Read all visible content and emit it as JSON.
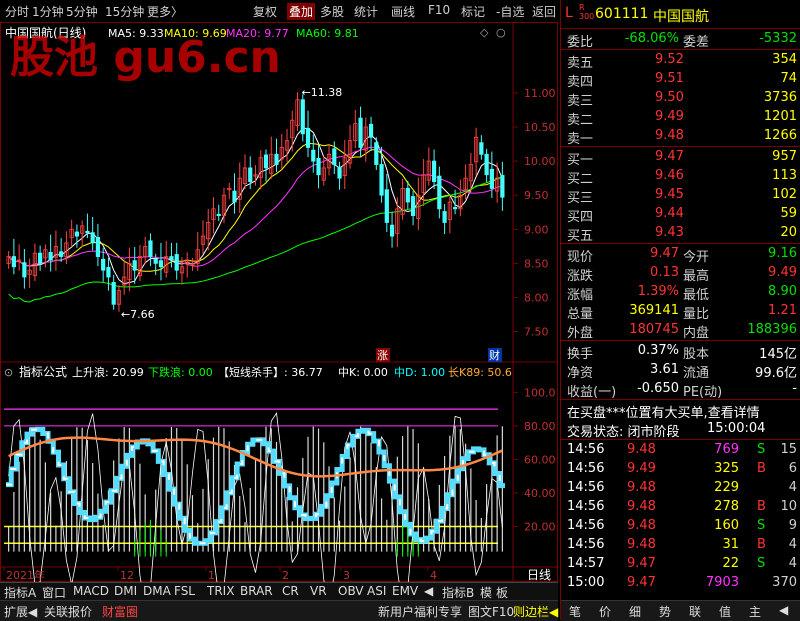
{
  "toolbar": {
    "items": [
      "分时",
      "1分钟",
      "5分钟",
      "15分钟",
      "更多〉",
      "复权",
      "叠加",
      "多股",
      "统计",
      "画线",
      "F10",
      "标记",
      "-自选",
      "返回"
    ],
    "active_index": 6
  },
  "main_chart": {
    "title": "中国国航(日线)",
    "ma_labels": [
      {
        "text": "MA5: 9.33",
        "color": "#ffffff"
      },
      {
        "text": "MA10: 9.69",
        "color": "#ffff00"
      },
      {
        "text": "MA20: 9.77",
        "color": "#ff33ff"
      },
      {
        "text": "MA60: 9.81",
        "color": "#00ff00"
      }
    ],
    "watermark": "股池 gu6.cn",
    "high_label": "←11.38",
    "low_label": "←7.66",
    "y_ticks": [
      "11.00",
      "10.50",
      "10.00",
      "9.50",
      "9.00",
      "8.50",
      "8.00",
      "7.50"
    ],
    "marker_zhang": "涨",
    "marker_cai": "财"
  },
  "indicator": {
    "header": "指标公式",
    "labels": [
      {
        "text": "上升浪: 20.99",
        "color": "#ffffff"
      },
      {
        "text": "下跌浪: 0.00",
        "color": "#00ff00"
      },
      {
        "text": "【短线杀手】: 36.77",
        "color": "#ffffff"
      },
      {
        "text": "中K: 0.00",
        "color": "#ffffff"
      },
      {
        "text": "中D: 1.00",
        "color": "#00ffff"
      },
      {
        "text": "长K89: 50.6",
        "color": "#ffaa33"
      }
    ],
    "y_ticks": [
      "100.0",
      "80.00",
      "60.00",
      "40.00",
      "20.00"
    ]
  },
  "x_axis": {
    "labels": [
      "2021年",
      "12",
      "1",
      "2",
      "3",
      "4"
    ],
    "period": "日线"
  },
  "tabs": [
    "指标A",
    "窗口",
    "MACD",
    "DMI",
    "DMA",
    "FSL",
    "TRIX",
    "BRAR",
    "CR",
    "VR",
    "OBV",
    "ASI",
    "EMV",
    "◀",
    "指标B",
    "模",
    "板"
  ],
  "bottom_bar": {
    "left": [
      "扩展◀",
      "关联报价",
      "财富圈"
    ],
    "right": [
      "新用户福利专享",
      "图文F10",
      "则边栏◀"
    ]
  },
  "quote": {
    "code": "601111",
    "name": "中国国航",
    "market_tag": "L",
    "sub_tag": "R 300",
    "webi_label": "委比",
    "webi_value": "-68.06%",
    "wecha_label": "委差",
    "wecha_value": "-5332",
    "asks": [
      {
        "label": "卖五",
        "price": "9.52",
        "vol": "354"
      },
      {
        "label": "卖四",
        "price": "9.51",
        "vol": "74"
      },
      {
        "label": "卖三",
        "price": "9.50",
        "vol": "3736"
      },
      {
        "label": "卖二",
        "price": "9.49",
        "vol": "1201"
      },
      {
        "label": "卖一",
        "price": "9.48",
        "vol": "1266"
      }
    ],
    "bids": [
      {
        "label": "买一",
        "price": "9.47",
        "vol": "957"
      },
      {
        "label": "买二",
        "price": "9.46",
        "vol": "113"
      },
      {
        "label": "买三",
        "price": "9.45",
        "vol": "102"
      },
      {
        "label": "买四",
        "price": "9.44",
        "vol": "59"
      },
      {
        "label": "买五",
        "price": "9.43",
        "vol": "20"
      }
    ],
    "stats": [
      {
        "l1": "现价",
        "v1": "9.47",
        "c1": "#ff3333",
        "l2": "今开",
        "v2": "9.16",
        "c2": "#00e000"
      },
      {
        "l1": "涨跌",
        "v1": "0.13",
        "c1": "#ff3333",
        "l2": "最高",
        "v2": "9.49",
        "c2": "#ff3333"
      },
      {
        "l1": "涨幅",
        "v1": "1.39%",
        "c1": "#ff3333",
        "l2": "最低",
        "v2": "8.90",
        "c2": "#00e000"
      },
      {
        "l1": "总量",
        "v1": "369141",
        "c1": "#ffff00",
        "l2": "量比",
        "v2": "1.21",
        "c2": "#ff3333"
      },
      {
        "l1": "外盘",
        "v1": "180745",
        "c1": "#ff3333",
        "l2": "内盘",
        "v2": "188396",
        "c2": "#00e000"
      }
    ],
    "stats2": [
      {
        "l1": "换手",
        "v1": "0.37%",
        "l2": "股本",
        "v2": "145亿"
      },
      {
        "l1": "净资",
        "v1": "3.61",
        "l2": "流通",
        "v2": "99.6亿"
      },
      {
        "l1": "收益(一)",
        "v1": "-0.650",
        "l2": "PE(动)",
        "v2": "-"
      }
    ],
    "notice": "在买盘***位置有大买单,查看详情",
    "status_label": "交易状态: 闭市阶段",
    "status_time": "15:00:04",
    "trades": [
      {
        "time": "14:56",
        "price": "9.48",
        "vol": "769",
        "side": "S",
        "n": "15",
        "vc": "#ff33ff"
      },
      {
        "time": "14:56",
        "price": "9.49",
        "vol": "325",
        "side": "B",
        "n": "6",
        "vc": "#ffff00"
      },
      {
        "time": "14:56",
        "price": "9.48",
        "vol": "229",
        "side": "",
        "n": "4",
        "vc": "#ffff00"
      },
      {
        "time": "14:56",
        "price": "9.48",
        "vol": "278",
        "side": "B",
        "n": "10",
        "vc": "#ffff00"
      },
      {
        "time": "14:56",
        "price": "9.48",
        "vol": "160",
        "side": "S",
        "n": "9",
        "vc": "#ffff00"
      },
      {
        "time": "14:56",
        "price": "9.48",
        "vol": "31",
        "side": "B",
        "n": "4",
        "vc": "#ffff00"
      },
      {
        "time": "14:57",
        "price": "9.47",
        "vol": "22",
        "side": "S",
        "n": "4",
        "vc": "#ffff00"
      },
      {
        "time": "15:00",
        "price": "9.47",
        "vol": "7903",
        "side": "",
        "n": "370",
        "vc": "#ff33ff"
      }
    ],
    "buttons": [
      "笔",
      "价",
      "细",
      "势",
      "联",
      "值",
      "主",
      "◀"
    ]
  },
  "chart_data": {
    "type": "candlestick",
    "y_range": [
      7.2,
      11.6
    ],
    "indicator_range": [
      0,
      105
    ],
    "closes": [
      8.6,
      8.45,
      8.55,
      8.3,
      8.4,
      8.65,
      8.5,
      8.7,
      8.55,
      8.75,
      8.6,
      8.8,
      9.0,
      8.9,
      9.05,
      8.95,
      8.8,
      8.6,
      8.4,
      8.3,
      7.9,
      8.1,
      8.3,
      8.5,
      8.4,
      8.6,
      8.75,
      8.6,
      8.5,
      8.45,
      8.6,
      8.55,
      8.4,
      8.45,
      8.55,
      8.5,
      8.7,
      8.9,
      9.1,
      9.3,
      9.2,
      9.5,
      9.6,
      9.4,
      9.75,
      9.9,
      9.7,
      9.8,
      10.05,
      9.9,
      10.1,
      9.95,
      10.2,
      10.3,
      10.6,
      10.9,
      10.4,
      10.2,
      10.0,
      9.8,
      9.9,
      10.1,
      9.95,
      9.75,
      10.05,
      10.3,
      10.55,
      10.2,
      10.5,
      10.35,
      9.95,
      9.5,
      9.1,
      8.9,
      9.3,
      9.6,
      9.4,
      9.2,
      9.5,
      9.8,
      10.0,
      9.7,
      9.3,
      9.1,
      9.4,
      9.3,
      9.5,
      9.75,
      9.95,
      10.35,
      10.1,
      9.8,
      9.6,
      9.75,
      9.47
    ]
  }
}
